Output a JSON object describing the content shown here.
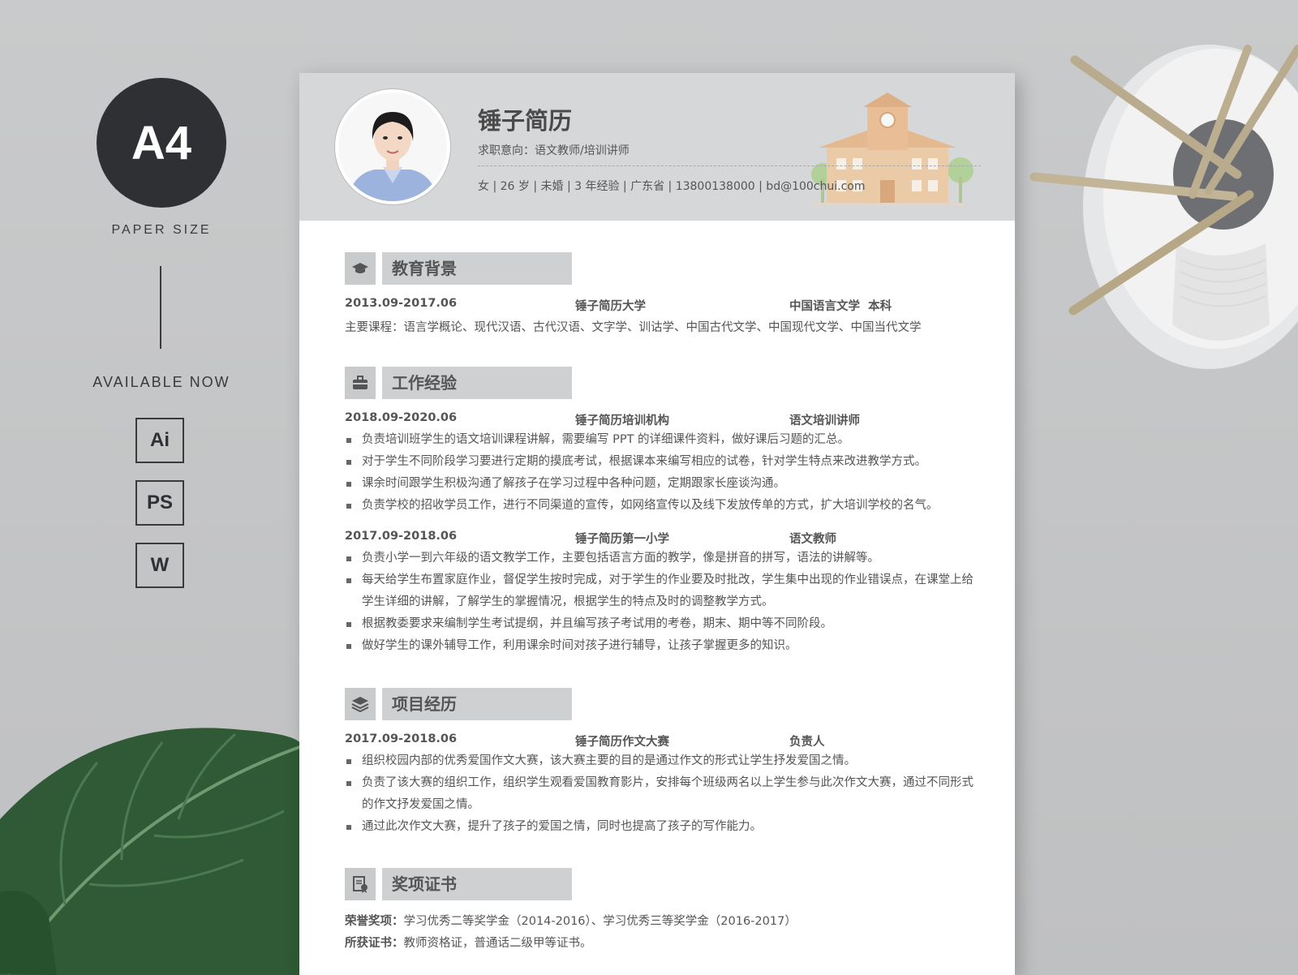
{
  "promo": {
    "size": "A4",
    "paper_size": "PAPER SIZE",
    "available": "AVAILABLE NOW",
    "formats": [
      "Ai",
      "PS",
      "W"
    ]
  },
  "resume": {
    "name": "锤子简历",
    "intent": "求职意向：语文教师/培训讲师",
    "info": "女 | 26 岁 | 未婚 | 3 年经验 | 广东省 | 13800138000 | bd@100chui.com",
    "education": {
      "title": "教育背景",
      "date": "2013.09-2017.06",
      "school": "锤子简历大学",
      "major": "中国语言文学  本科",
      "courses": "主要课程：语言学概论、现代汉语、古代汉语、文字学、训诂学、中国古代文学、中国现代文学、中国当代文学"
    },
    "work": {
      "title": "工作经验",
      "jobs": [
        {
          "date": "2018.09-2020.06",
          "org": "锤子简历培训机构",
          "role": "语文培训讲师",
          "items": [
            "负责培训班学生的语文培训课程讲解，需要编写 PPT 的详细课件资料，做好课后习题的汇总。",
            "对于学生不同阶段学习要进行定期的摸底考试，根据课本来编写相应的试卷，针对学生特点来改进教学方式。",
            "课余时间跟学生积极沟通了解孩子在学习过程中各种问题，定期跟家长座谈沟通。",
            "负责学校的招收学员工作，进行不同渠道的宣传，如网络宣传以及线下发放传单的方式，扩大培训学校的名气。"
          ]
        },
        {
          "date": "2017.09-2018.06",
          "org": "锤子简历第一小学",
          "role": "语文教师",
          "items": [
            "负责小学一到六年级的语文教学工作，主要包括语言方面的教学，像是拼音的拼写，语法的讲解等。",
            "每天给学生布置家庭作业，督促学生按时完成，对于学生的作业要及时批改，学生集中出现的作业错误点，在课堂上给学生详细的讲解，了解学生的掌握情况，根据学生的特点及时的调整教学方式。",
            "根据教委要求来编制学生考试提纲，并且编写孩子考试用的考卷，期末、期中等不同阶段。",
            "做好学生的课外辅导工作，利用课余时间对孩子进行辅导，让孩子掌握更多的知识。"
          ]
        }
      ]
    },
    "project": {
      "title": "项目经历",
      "date": "2017.09-2018.06",
      "name": "锤子简历作文大赛",
      "role": "负责人",
      "items": [
        "组织校园内部的优秀爱国作文大赛，该大赛主要的目的是通过作文的形式让学生抒发爱国之情。",
        "负责了该大赛的组织工作，组织学生观看爱国教育影片，安排每个班级两名以上学生参与此次作文大赛，通过不同形式的作文抒发爱国之情。",
        "通过此次作文大赛，提升了孩子的爱国之情，同时也提高了孩子的写作能力。"
      ]
    },
    "awards": {
      "title": "奖项证书",
      "honor_label": "荣誉奖项：",
      "honor": "学习优秀二等奖学金（2014-2016）、学习优秀三等奖学金（2016-2017）",
      "cert_label": "所获证书：",
      "cert": "教师资格证，普通话二级甲等证书。"
    }
  },
  "icons": [
    "graduation-cap-icon",
    "briefcase-icon",
    "layers-icon",
    "certificate-icon"
  ]
}
